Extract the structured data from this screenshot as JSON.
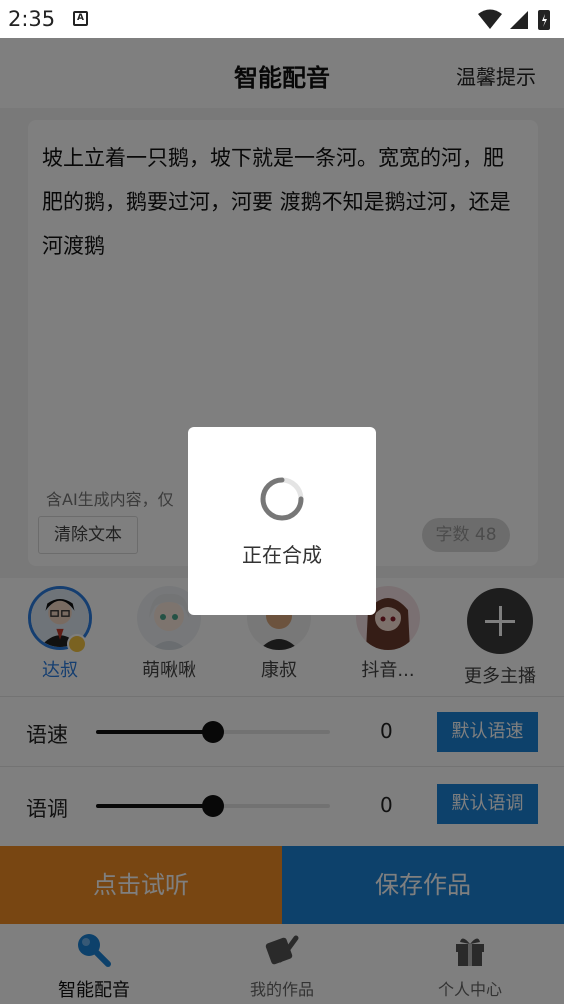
{
  "status": {
    "time": "2:35",
    "notif_glyph": "A"
  },
  "header": {
    "title": "智能配音",
    "tip": "温馨提示"
  },
  "editor": {
    "text": "坡上立着一只鹅，坡下就是一条河。宽宽的河，肥肥的鹅，鹅要过河，河要 渡鹅不知是鹅过河，还是河渡鹅",
    "ai_note": "含AI生成内容，仅",
    "clear_label": "清除文本",
    "count_label": "字数 48"
  },
  "voices": [
    {
      "name": "达叔",
      "selected": true
    },
    {
      "name": "萌啾啾",
      "selected": false
    },
    {
      "name": "康叔",
      "selected": false
    },
    {
      "name": "抖音...",
      "selected": false
    }
  ],
  "more_voices_label": "更多主播",
  "speed": {
    "label": "语速",
    "value": "0",
    "level": 0.5,
    "button": "默认语速"
  },
  "pitch": {
    "label": "语调",
    "value": "0",
    "level": 0.5,
    "button": "默认语调"
  },
  "actions": {
    "listen": "点击试听",
    "save": "保存作品"
  },
  "tabs": [
    {
      "label": "智能配音",
      "icon": "microphone-icon",
      "active": true
    },
    {
      "label": "我的作品",
      "icon": "works-icon",
      "active": false
    },
    {
      "label": "个人中心",
      "icon": "gift-icon",
      "active": false
    }
  ],
  "dialog": {
    "message": "正在合成"
  },
  "colors": {
    "accent_blue": "#1a82d6",
    "accent_orange": "#f08c24",
    "overlay": "rgba(0,0,0,0.5)"
  }
}
